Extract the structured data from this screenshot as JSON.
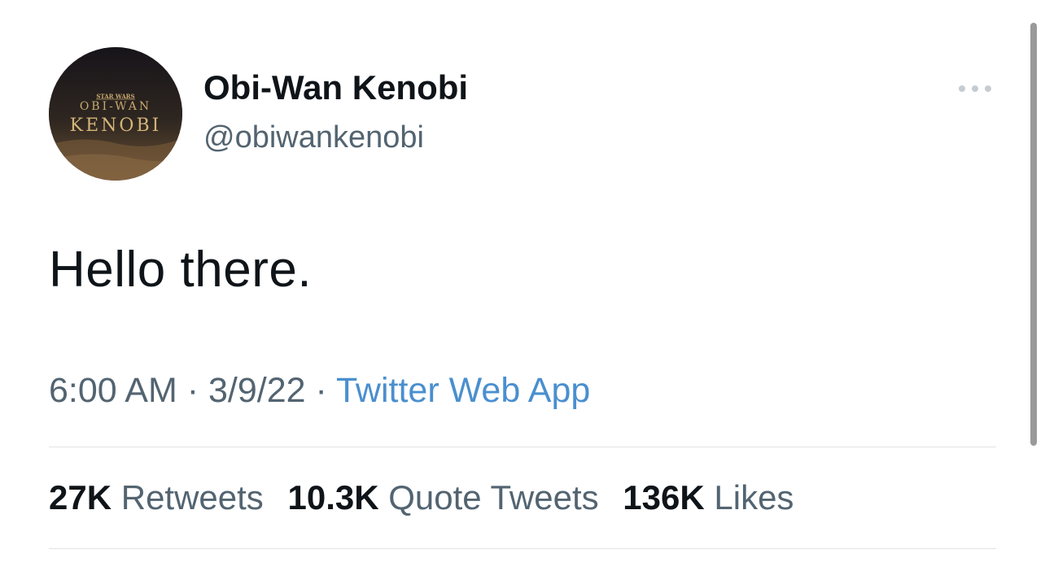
{
  "tweet": {
    "author": {
      "display_name": "Obi-Wan Kenobi",
      "handle": "@obiwankenobi",
      "avatar_logo": {
        "line1": "STAR WARS",
        "line2": "OBI-WAN",
        "line3": "KENOBI"
      }
    },
    "text": "Hello there.",
    "time": "6:00 AM",
    "separator": "·",
    "date": "3/9/22",
    "source": "Twitter Web App",
    "stats": {
      "retweets_count": "27K",
      "retweets_label": "Retweets",
      "quotes_count": "10.3K",
      "quotes_label": "Quote Tweets",
      "likes_count": "136K",
      "likes_label": "Likes"
    }
  },
  "colors": {
    "text_primary": "#0f1419",
    "text_secondary": "#536471",
    "link": "#4a8fcf",
    "divider": "#dfe3e6"
  }
}
